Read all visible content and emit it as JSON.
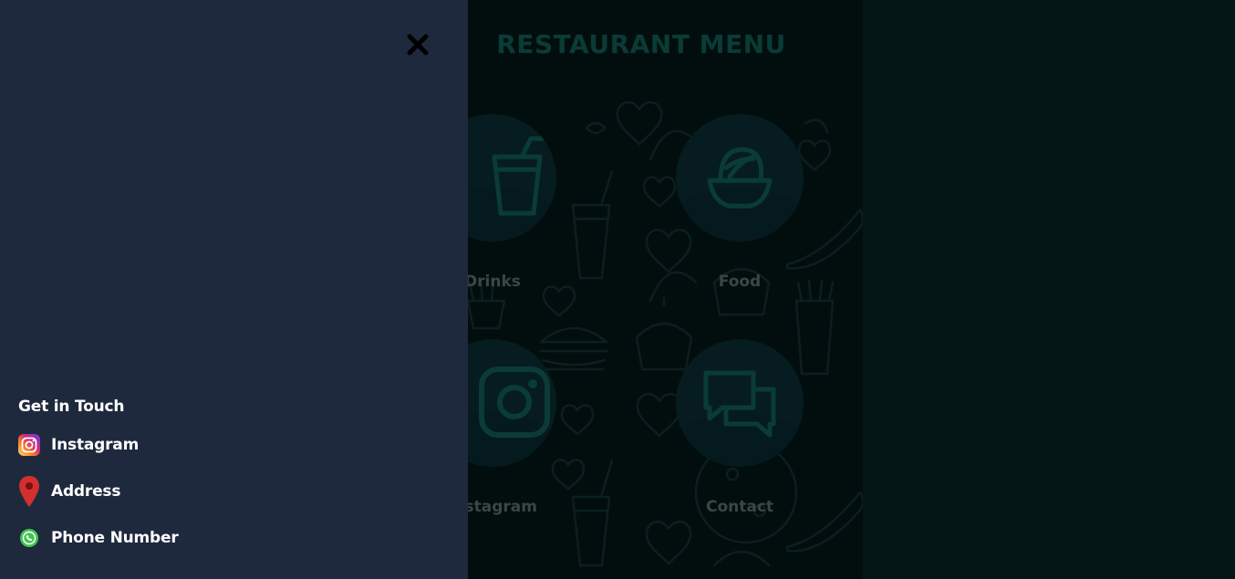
{
  "menu": {
    "title": "RESTAURANT MENU",
    "cards": [
      {
        "label": "Drinks",
        "icon": "drink-cup-icon"
      },
      {
        "label": "Food",
        "icon": "food-bowl-icon"
      },
      {
        "label": "Instagram",
        "icon": "instagram-icon"
      },
      {
        "label": "Contact",
        "icon": "chat-bubbles-icon"
      }
    ]
  },
  "sidebar": {
    "close_icon": "close-icon",
    "contact_title": "Get in Touch",
    "items": [
      {
        "label": "Instagram",
        "icon": "instagram-icon"
      },
      {
        "label": "Address",
        "icon": "map-pin-icon"
      },
      {
        "label": "Phone Number",
        "icon": "whatsapp-icon"
      }
    ]
  },
  "colors": {
    "sidebar_bg": "#1e293d",
    "overlay_bg": "#041615",
    "menu_title": "#0a3b37",
    "icon_teal": "#0a3b37",
    "address_pin": "#d32f2f",
    "whatsapp": "#43c553"
  }
}
